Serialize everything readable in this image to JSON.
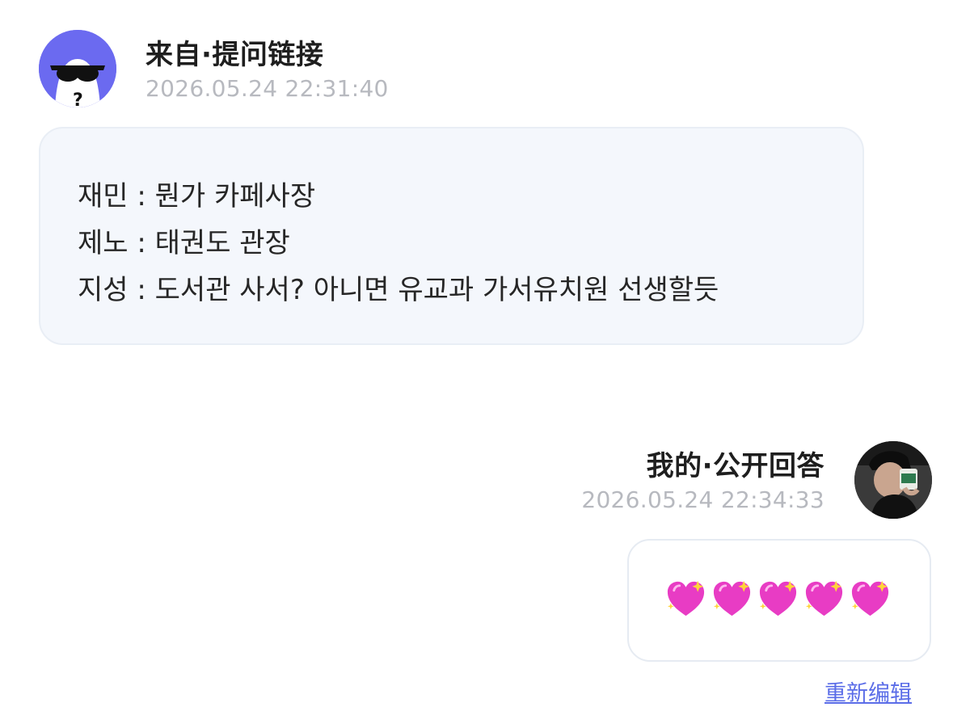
{
  "question": {
    "header_title": "来自·提问链接",
    "timestamp": "2026.05.24 22:31:40",
    "avatar_icon": "sunglasses-ghost-avatar",
    "lines": [
      "재민 : 뭔가 카페사장",
      "제노 : 태권도 관장",
      "지성 : 도서관 사서? 아니면 유교과 가서유치원 선생할듯"
    ]
  },
  "answer": {
    "header_title": "我的·公开回答",
    "timestamp": "2026.05.24 22:34:33",
    "avatar_icon": "user-photo-avatar",
    "content_icon": "sparkling-heart-icon",
    "heart_count": 5,
    "re_edit_label": "重新编辑"
  },
  "colors": {
    "accent_purple": "#6b6af0",
    "link_blue": "#5b6de8",
    "timestamp_gray": "#b7b9bf",
    "bubble_bg": "#f4f7fc",
    "heart_pink": "#e83cc4"
  }
}
